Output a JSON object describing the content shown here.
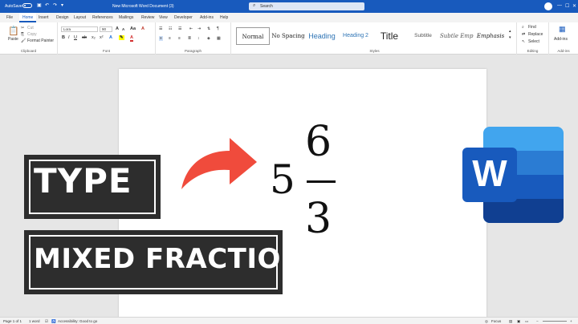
{
  "titlebar": {
    "autosave_label": "AutoSave",
    "toggle_state": "Off",
    "document_title": "New Microsoft Word Document (3)",
    "search_placeholder": "Search"
  },
  "tabs": [
    "File",
    "Home",
    "Insert",
    "Design",
    "Layout",
    "References",
    "Mailings",
    "Review",
    "View",
    "Developer",
    "Add-ins",
    "Help"
  ],
  "active_tab": "Home",
  "ribbon": {
    "clipboard": {
      "paste": "Paste",
      "cut": "Cut",
      "copy": "Copy",
      "format_painter": "Format Painter",
      "label": "Clipboard"
    },
    "font": {
      "font_name": "Lora",
      "font_size": "90",
      "label": "Font"
    },
    "paragraph": {
      "label": "Paragraph"
    },
    "styles": {
      "items": [
        "Normal",
        "No Spacing",
        "Heading",
        "Heading 2",
        "Title",
        "Subtitle",
        "Subtle Emp...",
        "Emphasis"
      ],
      "label": "Styles"
    },
    "editing": {
      "find": "Find",
      "replace": "Replace",
      "select": "Select",
      "label": "Editing"
    },
    "addins": {
      "button": "Add-ins",
      "label": "Add-ins"
    }
  },
  "document": {
    "whole": "5",
    "numerator": "6",
    "denominator": "3"
  },
  "overlay": {
    "line1": "TYPE",
    "line2": "MIXED FRACTION",
    "logo_letter": "W",
    "colors": {
      "banner_bg": "#2d2d2d",
      "arrow": "#f04b3c",
      "word_dark": "#185abd"
    }
  },
  "statusbar": {
    "page": "Page 1 of 1",
    "words": "1 word",
    "accessibility": "Accessibility: Good to go",
    "focus": "Focus"
  }
}
